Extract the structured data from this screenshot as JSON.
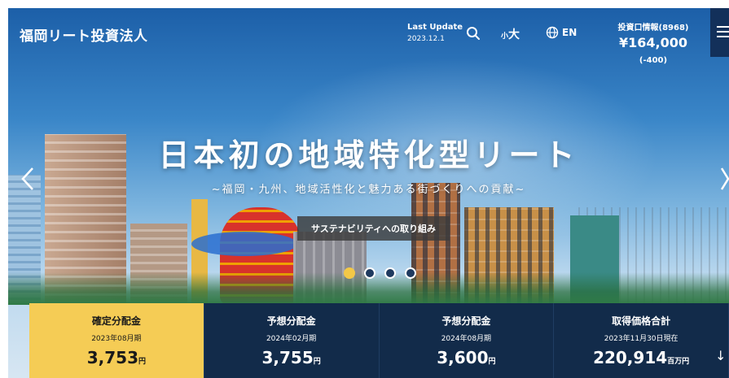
{
  "header": {
    "logo": "福岡リート投資法人",
    "last_update_label": "Last Update",
    "last_update_date": "2023.12.1",
    "fontsize_small": "小",
    "fontsize_large": "大",
    "language": "EN",
    "unit_info_label": "投資口情報(8968)",
    "unit_price": "¥164,000",
    "unit_change": "(-400)"
  },
  "hero": {
    "headline": "日本初の地域特化型リート",
    "subline": "~福岡・九州、地域活性化と魅力ある街づくりへの貢献~",
    "sustainability_button": "サステナビリティへの取り組み",
    "slide_count": 4,
    "active_slide": 0
  },
  "stats": [
    {
      "title": "確定分配金",
      "period": "2023年08月期",
      "value": "3,753",
      "unit": "円",
      "active": true
    },
    {
      "title": "予想分配金",
      "period": "2024年02月期",
      "value": "3,755",
      "unit": "円",
      "active": false
    },
    {
      "title": "予想分配金",
      "period": "2024年08月期",
      "value": "3,600",
      "unit": "円",
      "active": false
    },
    {
      "title": "取得価格合計",
      "period": "2023年11月30日現在",
      "value": "220,914",
      "unit": "百万円",
      "active": false
    }
  ],
  "scroll_down": "↓",
  "colors": {
    "navy": "#122b4a",
    "accent": "#f5cc55"
  }
}
